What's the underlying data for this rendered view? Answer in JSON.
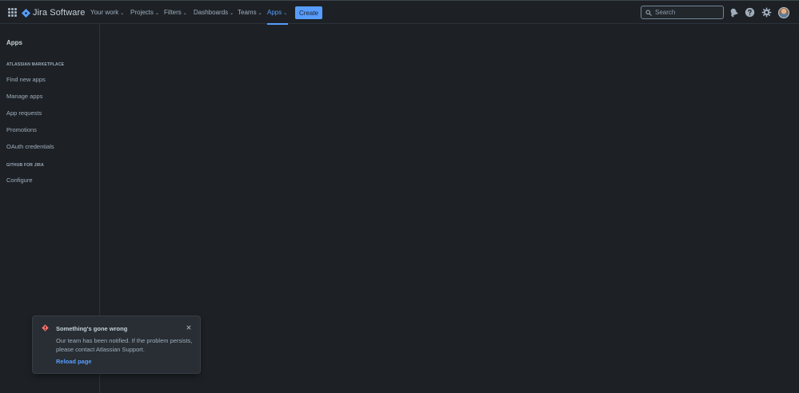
{
  "app": {
    "product_name": "Jira Software"
  },
  "topnav": {
    "items": [
      {
        "label": "Your work"
      },
      {
        "label": "Projects"
      },
      {
        "label": "Filters"
      },
      {
        "label": "Dashboards"
      },
      {
        "label": "Teams"
      },
      {
        "label": "Apps",
        "active": true
      }
    ],
    "create_label": "Create",
    "search_placeholder": "Search",
    "icons": [
      "app-switcher-icon",
      "notifications-icon",
      "help-icon",
      "settings-icon"
    ]
  },
  "sidebar": {
    "title": "Apps",
    "sections": [
      {
        "heading": "ATLASSIAN MARKETPLACE",
        "items": [
          {
            "label": "Find new apps"
          },
          {
            "label": "Manage apps"
          },
          {
            "label": "App requests"
          },
          {
            "label": "Promotions"
          },
          {
            "label": "OAuth credentials"
          }
        ]
      },
      {
        "heading": "GITHUB FOR JIRA",
        "items": [
          {
            "label": "Configure"
          }
        ]
      }
    ]
  },
  "error_flag": {
    "title": "Something's gone wrong",
    "body": "Our team has been notified. If the problem persists, please contact Atlassian Support.",
    "action_label": "Reload page"
  },
  "colors": {
    "background": "#1d2125",
    "accent": "#579dff",
    "error": "#f87168"
  }
}
